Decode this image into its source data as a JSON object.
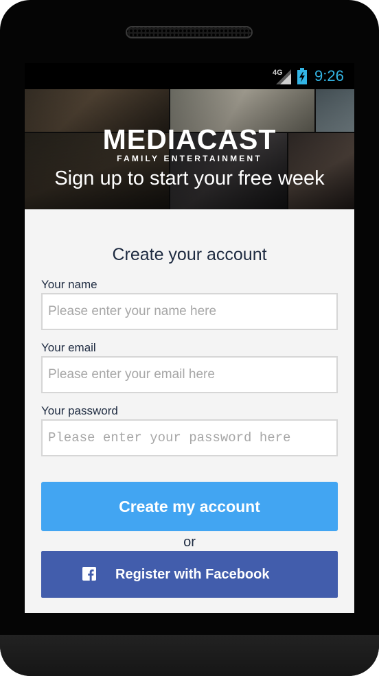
{
  "status_bar": {
    "network": "4G",
    "time": "9:26",
    "clock_color": "#33b5e5"
  },
  "hero": {
    "brand": "MEDIACAST",
    "brand_subtitle": "FAMILY ENTERTAINMENT",
    "tagline": "Sign up to start your free week"
  },
  "form": {
    "title": "Create your account",
    "name_field": {
      "label": "Your name",
      "placeholder": "Please enter your name here"
    },
    "email_field": {
      "label": "Your email",
      "placeholder": "Please enter your email here"
    },
    "password_field": {
      "label": "Your password",
      "placeholder": "Please enter your password here"
    },
    "submit_label": "Create my account",
    "separator": "or",
    "facebook_label": "Register with Facebook"
  },
  "colors": {
    "primary_button": "#42a5f2",
    "facebook_button": "#425dac",
    "text": "#1d2a40",
    "panel_background": "#f4f4f4"
  }
}
